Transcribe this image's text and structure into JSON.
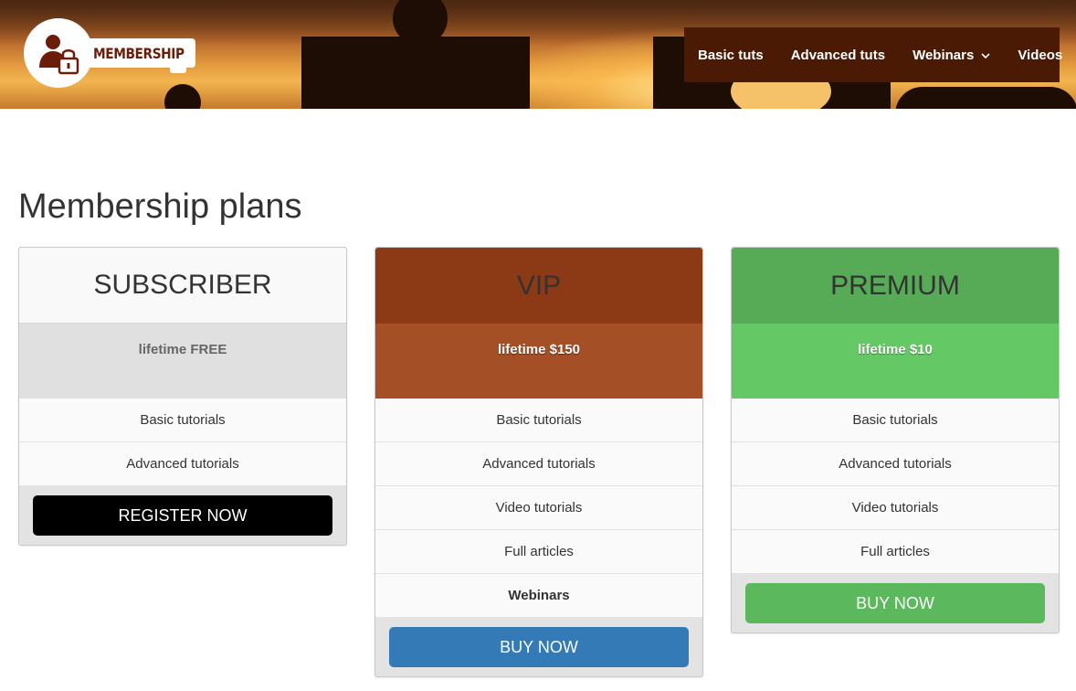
{
  "header": {
    "logo_text": "MEMBERSHIP",
    "nav": [
      {
        "label": "Basic tuts"
      },
      {
        "label": "Advanced tuts"
      },
      {
        "label": "Webinars",
        "has_dropdown": true,
        "icon": "chevron-down-icon"
      },
      {
        "label": "Videos"
      }
    ]
  },
  "page_title": "Membership plans",
  "plans": [
    {
      "name": "SUBSCRIBER",
      "price": "lifetime FREE",
      "features": [
        "Basic tutorials",
        "Advanced tutorials"
      ],
      "button": "REGISTER NOW",
      "colors": {
        "header": "#f9f9f9",
        "price": "#e0e0e0",
        "button": "#000000"
      }
    },
    {
      "name": "VIP",
      "price": "lifetime $150",
      "features": [
        "Basic tutorials",
        "Advanced tutorials",
        "Video tutorials",
        "Full articles",
        "Webinars"
      ],
      "button": "BUY NOW",
      "colors": {
        "header": "#8b3a15",
        "price": "#a44f26",
        "button": "#337ab7"
      }
    },
    {
      "name": "PREMIUM",
      "price": "lifetime $10",
      "features": [
        "Basic tutorials",
        "Advanced tutorials",
        "Video tutorials",
        "Full articles"
      ],
      "button": "BUY NOW",
      "colors": {
        "header": "#57ab57",
        "price": "#64c864",
        "button": "#5cb85c"
      }
    }
  ]
}
